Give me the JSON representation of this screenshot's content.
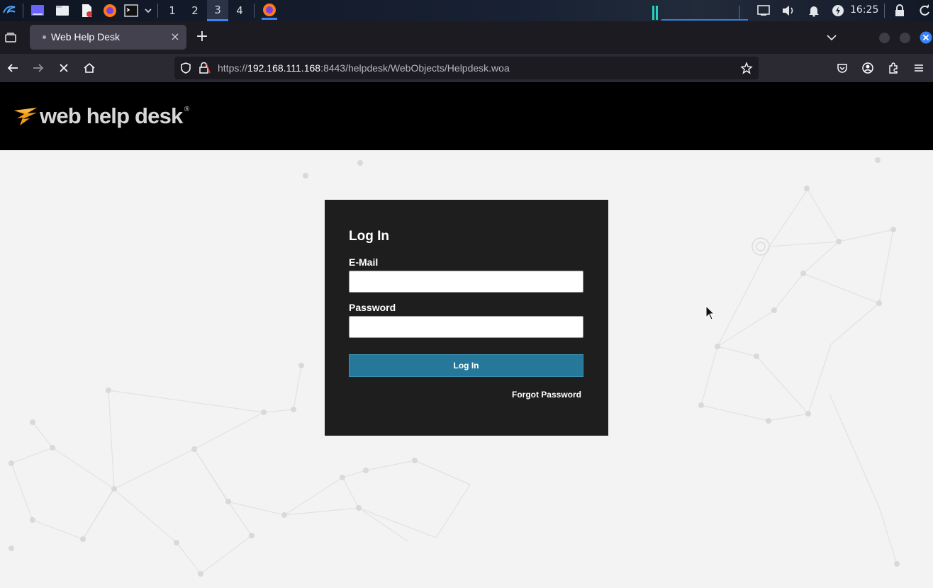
{
  "os_panel": {
    "workspaces": [
      "1",
      "2",
      "3",
      "4"
    ],
    "clock": "16:25",
    "icons": [
      "kali-menu-icon",
      "desktop-icon",
      "file-manager-icon",
      "text-editor-icon",
      "firefox-icon",
      "terminal-icon",
      "chevron-down-icon",
      "firefox-window-icon",
      "network-icon",
      "volume-icon",
      "bell-icon",
      "power-icon",
      "lock-icon",
      "refresh-icon"
    ]
  },
  "browser": {
    "tab": {
      "title": "Web Help Desk",
      "close": "×"
    },
    "new_tab": "+",
    "url": {
      "scheme": "https://",
      "host": "192.168.111.168",
      "rest": ":8443/helpdesk/WebObjects/Helpdesk.woa"
    }
  },
  "page": {
    "logo": {
      "text": "web help desk",
      "reg": "®"
    },
    "login": {
      "title": "Log In",
      "email_label": "E-Mail",
      "email_value": "",
      "password_label": "Password",
      "password_value": "",
      "submit": "Log In",
      "forgot": "Forgot Password"
    }
  },
  "colors": {
    "accent": "#25789a",
    "header": "#000000",
    "card": "#1e1e1e",
    "logo_orange": "#f39c12"
  }
}
